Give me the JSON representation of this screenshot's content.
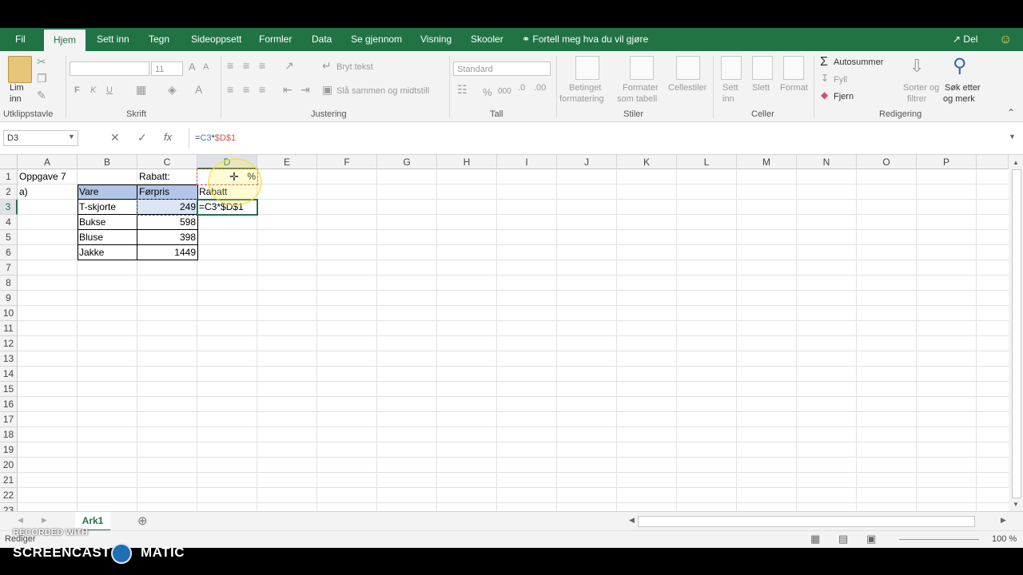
{
  "tabs": [
    "Fil",
    "Hjem",
    "Sett inn",
    "Tegn",
    "Sideoppsett",
    "Formler",
    "Data",
    "Se gjennom",
    "Visning",
    "Skooler"
  ],
  "active_tab": "Hjem",
  "tell_me": "Fortell meg hva du vil gjøre",
  "share": "Del",
  "ribbon": {
    "clipboard": {
      "paste_line1": "Lim",
      "paste_line2": "inn",
      "group": "Utklippstavle"
    },
    "font": {
      "size": "11",
      "bold": "F",
      "italic": "K",
      "underline": "U",
      "group": "Skrift"
    },
    "alignment": {
      "wrap": "Bryt tekst",
      "merge": "Slå sammen og midtstill",
      "group": "Justering"
    },
    "number": {
      "format": "Standard",
      "percent": "%",
      "thousands": "000",
      "group": "Tall"
    },
    "styles": {
      "cond1": "Betinget",
      "cond2": "formatering",
      "table1": "Formater",
      "table2": "som tabell",
      "cell": "Cellestiler",
      "group": "Stiler"
    },
    "cells": {
      "insert1": "Sett",
      "insert2": "inn",
      "delete": "Slett",
      "format": "Format",
      "group": "Celler"
    },
    "editing": {
      "autosum": "Autosummer",
      "fill": "Fyll",
      "clear": "Fjern",
      "sort1": "Sorter og",
      "sort2": "filtrer",
      "find1": "Søk etter",
      "find2": "og merk",
      "group": "Redigering"
    }
  },
  "formula_bar": {
    "name_box": "D3",
    "formula": "=C3*$D$1",
    "formula_ref1": "C3",
    "formula_ref2": "$D$1"
  },
  "columns": [
    "A",
    "B",
    "C",
    "D",
    "E",
    "F",
    "G",
    "H",
    "I",
    "J",
    "K",
    "L",
    "M",
    "N",
    "O",
    "P"
  ],
  "rows": [
    "1",
    "2",
    "3",
    "4",
    "5",
    "6",
    "7",
    "8",
    "9",
    "10",
    "11",
    "12",
    "13",
    "14",
    "15",
    "16",
    "17",
    "18",
    "19",
    "20",
    "21",
    "22",
    "23"
  ],
  "cells": {
    "A1": "Oppgave 7",
    "A2": "a)",
    "C1": "Rabatt:",
    "D1": "%",
    "B2": "Vare",
    "C2": "Førpris",
    "D2": "Rabatt",
    "B3": "T-skjorte",
    "C3": "249",
    "D3": "=C3*$D$1",
    "B4": "Bukse",
    "C4": "598",
    "B5": "Bluse",
    "C5": "398",
    "B6": "Jakke",
    "C6": "1449"
  },
  "sheet_tab": "Ark1",
  "status": "Rediger",
  "zoom": "100 %",
  "watermark": {
    "line1": "RECORDED WITH",
    "line2a": "SCREENCAST",
    "line2b": "MATIC"
  },
  "colors": {
    "excel_green": "#217346",
    "ref_blue": "#4472c4",
    "ref_red": "#d9534f"
  }
}
